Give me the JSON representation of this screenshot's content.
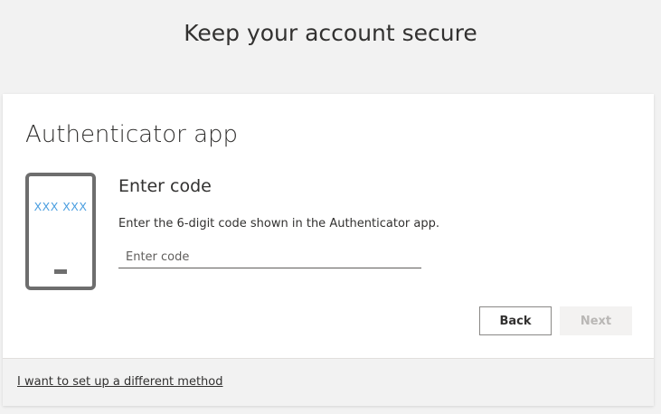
{
  "header": {
    "title": "Keep your account secure"
  },
  "card": {
    "title": "Authenticator app",
    "illustration": {
      "code_text": "XXX XXX",
      "icon": "phone-icon",
      "accent_color": "#4a9ee0"
    },
    "section_heading": "Enter code",
    "instructions": "Enter the 6-digit code shown in the Authenticator app.",
    "code_input": {
      "placeholder": "Enter code",
      "value": ""
    },
    "buttons": {
      "back_label": "Back",
      "next_label": "Next"
    }
  },
  "footer": {
    "alt_method_link": "I want to set up a different method"
  }
}
